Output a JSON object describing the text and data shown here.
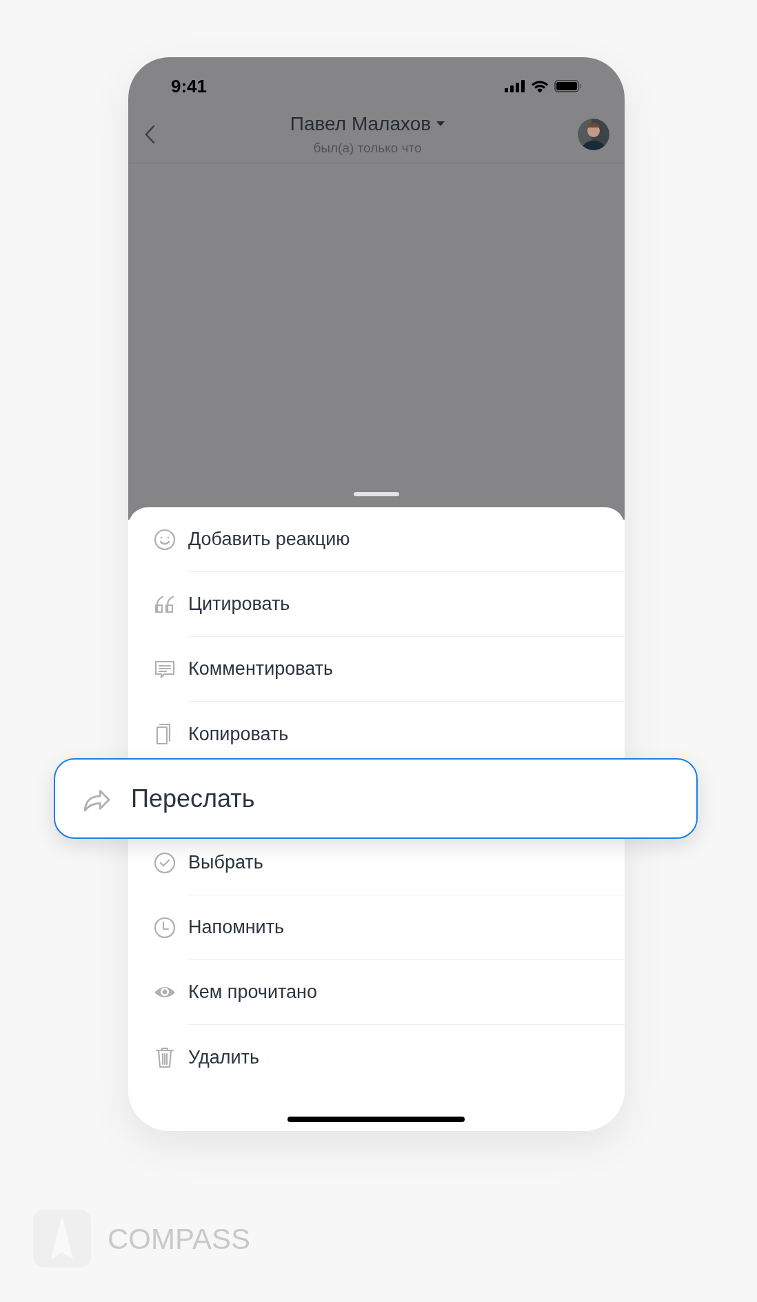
{
  "status_bar": {
    "time": "9:41"
  },
  "header": {
    "title": "Павел Малахов",
    "subtitle": "был(а) только что"
  },
  "menu": [
    {
      "label": "Добавить реакцию",
      "highlighted": false
    },
    {
      "label": "Цитировать",
      "highlighted": false
    },
    {
      "label": "Комментировать",
      "highlighted": false
    },
    {
      "label": "Копировать",
      "highlighted": false
    },
    {
      "label": "Переслать",
      "highlighted": true
    },
    {
      "label": "Выбрать",
      "highlighted": false
    },
    {
      "label": "Напомнить",
      "highlighted": false
    },
    {
      "label": "Кем прочитано",
      "highlighted": false
    },
    {
      "label": "Удалить",
      "highlighted": false
    }
  ],
  "brand": {
    "name": "COMPASS"
  }
}
